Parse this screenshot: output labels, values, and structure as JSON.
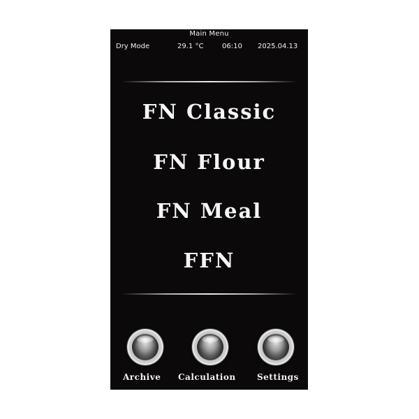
{
  "header": {
    "title": "Main Menu",
    "mode": "Dry Mode",
    "temperature": "29.1 °C",
    "time": "06:10",
    "date": "2025.04.13"
  },
  "menu": {
    "items": [
      {
        "label": "FN Classic"
      },
      {
        "label": "FN Flour"
      },
      {
        "label": "FN Meal"
      },
      {
        "label": "FFN"
      }
    ]
  },
  "footer": {
    "buttons": [
      {
        "label": "Archive"
      },
      {
        "label": "Calculation"
      },
      {
        "label": "Settings"
      }
    ]
  },
  "colors": {
    "background": "#0b0909",
    "text": "#f6f6f6"
  }
}
